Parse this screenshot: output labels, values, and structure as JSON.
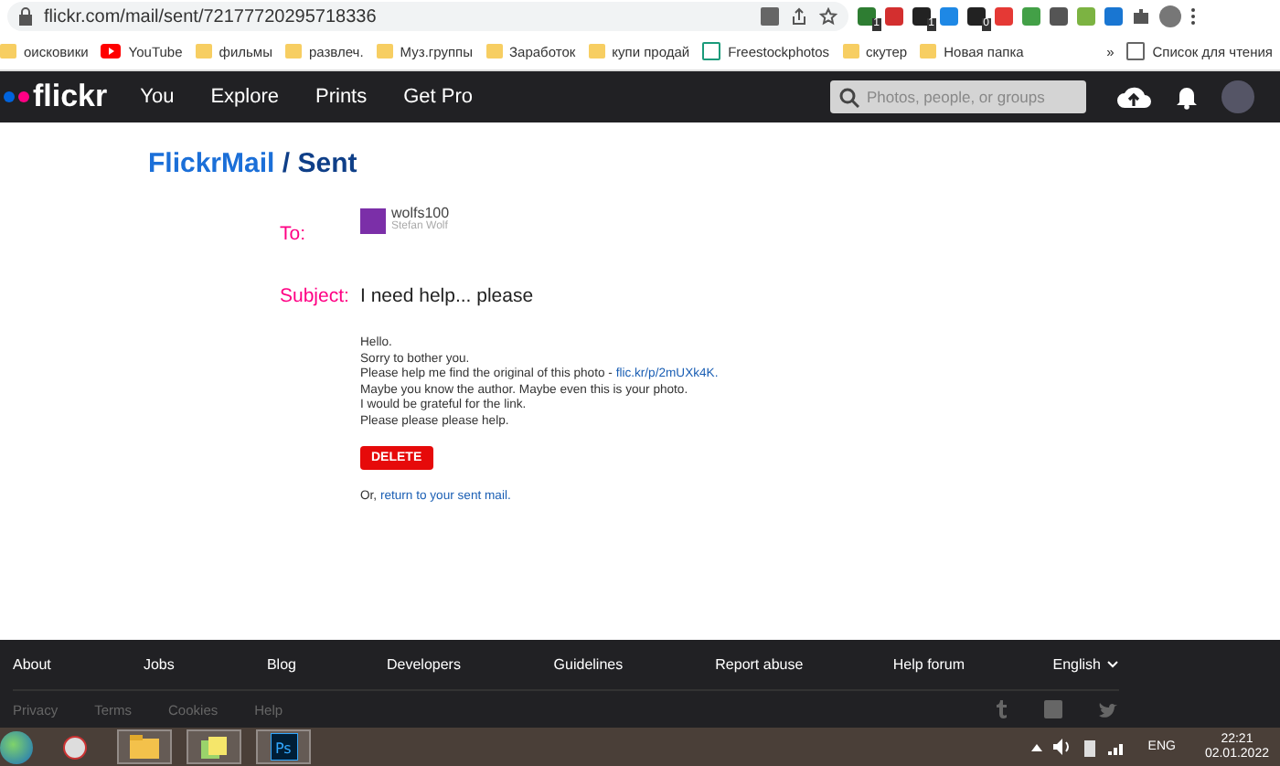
{
  "browser": {
    "address": "flickr.com/mail/sent/72177720295718336",
    "extensions": [
      {
        "color": "#2e7d32",
        "badge": "1"
      },
      {
        "color": "#d32f2f"
      },
      {
        "color": "#222222",
        "badge": "1"
      },
      {
        "color": "#1e88e5"
      },
      {
        "color": "#222222",
        "badge": "0"
      },
      {
        "color": "#e53935"
      },
      {
        "color": "#43a047"
      },
      {
        "color": "#555555"
      },
      {
        "color": "#7cb342"
      },
      {
        "color": "#1976d2"
      }
    ],
    "bookmarks": [
      {
        "kind": "folder",
        "label": "оисковики"
      },
      {
        "kind": "video",
        "label": "YouTube"
      },
      {
        "kind": "folder",
        "label": "фильмы"
      },
      {
        "kind": "folder",
        "label": "развлеч."
      },
      {
        "kind": "folder",
        "label": "Муз.группы"
      },
      {
        "kind": "folder",
        "label": "Заработок"
      },
      {
        "kind": "folder",
        "label": "купи продай"
      },
      {
        "kind": "site",
        "label": "Freestockphotos"
      },
      {
        "kind": "folder",
        "label": "скутер"
      },
      {
        "kind": "folder",
        "label": "Новая папка"
      }
    ],
    "more": "»",
    "reading_list": "Список для чтения"
  },
  "nav": {
    "logo": "flickr",
    "links": [
      "You",
      "Explore",
      "Prints",
      "Get Pro"
    ],
    "search": {
      "placeholder": "Photos, people, or groups"
    }
  },
  "page": {
    "title": "FlickrMail",
    "separator": " / ",
    "subtitle": "Sent",
    "to_label": "To:",
    "recipient": {
      "username": "wolfs100",
      "name": "Stefan Wolf"
    },
    "subject_label": "Subject:",
    "subject": "I need help... please",
    "body": [
      {
        "text": "Hello."
      },
      {
        "text": "Sorry to bother you."
      },
      {
        "text": "Please help me find the original of this photo - ",
        "link": "flic.kr/p/2mUXk4K."
      },
      {
        "text": "Maybe you know the author. Maybe even this is your photo."
      },
      {
        "text": "I would be grateful for the link."
      },
      {
        "text": "Please please please help."
      }
    ],
    "delete": "DELETE",
    "return_prefix": "Or, ",
    "return_link": "return to your sent mail."
  },
  "footer": {
    "links": [
      "About",
      "Jobs",
      "Blog",
      "Developers",
      "Guidelines",
      "Report abuse",
      "Help forum"
    ],
    "language": "English",
    "legal": [
      "Privacy",
      "Terms",
      "Cookies",
      "Help"
    ]
  },
  "taskbar": {
    "photoshop": "Ps",
    "language": "ENG",
    "time": "22:21",
    "date": "02.01.2022"
  }
}
